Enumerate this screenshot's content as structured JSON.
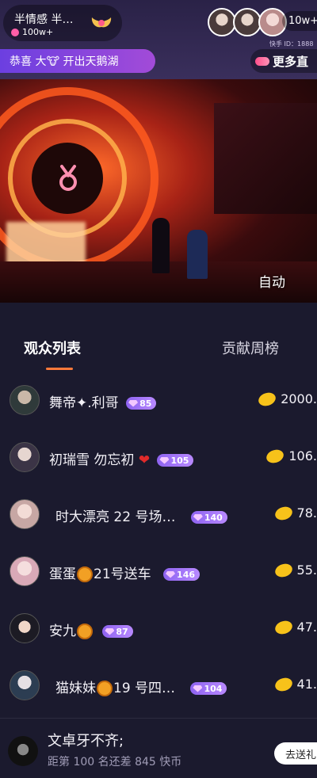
{
  "header": {
    "host_name": "半情感 半…",
    "host_fans": "100w+",
    "viewer_count": "10w+",
    "kuaishou_id": "快手 ID：1888",
    "gift_banner": "恭喜 大🐮 开出天鹅湖",
    "more_live": "更多直"
  },
  "video": {
    "auto_label": "自动"
  },
  "tabs": {
    "active": "观众列表",
    "inactive": "贡献周榜"
  },
  "viewers": [
    {
      "name": "舞帝✦.利哥",
      "level": "85",
      "score": "2000."
    },
    {
      "name": "初瑞雪 勿忘初",
      "has_heart": true,
      "level": "105",
      "score": "106."
    },
    {
      "name": "时大漂亮 22 号场…",
      "level": "140",
      "score": "78."
    },
    {
      "name_before": "蛋蛋",
      "name_after": "21号送车",
      "has_emoji": true,
      "level": "146",
      "score": "55."
    },
    {
      "name_before": "安九",
      "name_after": "",
      "has_emoji": true,
      "level": "87",
      "score": "47."
    },
    {
      "name_before": "猫妹妹",
      "name_after": "19 号四…",
      "has_emoji": true,
      "level": "104",
      "score": "41."
    }
  ],
  "me": {
    "name": "文卓牙不齐;",
    "gap_text": "距第 100 名还差 845 快币",
    "send_gift_label": "去送礼"
  },
  "colors": {
    "accent_tab": "#ff7a3a",
    "badge": "#8e63f0",
    "bean": "#f7c21a",
    "banner": "#6c3fe0"
  }
}
